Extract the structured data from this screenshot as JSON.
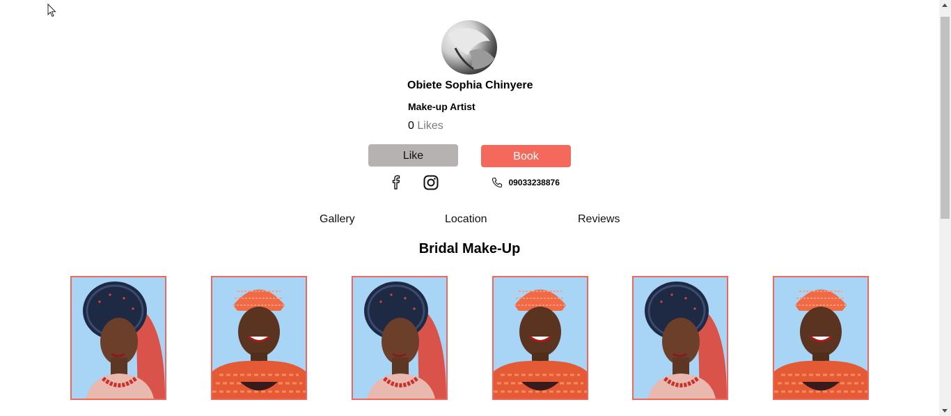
{
  "profile": {
    "name": "Obiete Sophia Chinyere",
    "role": "Make-up Artist",
    "likes_count": "0",
    "likes_label": "Likes"
  },
  "actions": {
    "like_label": "Like",
    "book_label": "Book"
  },
  "contact": {
    "phone": "09033238876",
    "social_icons": [
      "facebook-icon",
      "instagram-icon"
    ]
  },
  "tabs": [
    {
      "label": "Gallery"
    },
    {
      "label": "Location"
    },
    {
      "label": "Reviews"
    }
  ],
  "gallery": {
    "title": "Bridal Make-Up",
    "images": [
      {
        "style": "gele-headwrap"
      },
      {
        "style": "coral-beads"
      },
      {
        "style": "gele-headwrap"
      },
      {
        "style": "coral-beads"
      },
      {
        "style": "gele-headwrap"
      },
      {
        "style": "coral-beads"
      }
    ]
  },
  "colors": {
    "accent": "#f5695c",
    "like_button": "#b6b2b2",
    "thumb_border": "#f0665c",
    "thumb_bg": "#a8d4f5"
  }
}
